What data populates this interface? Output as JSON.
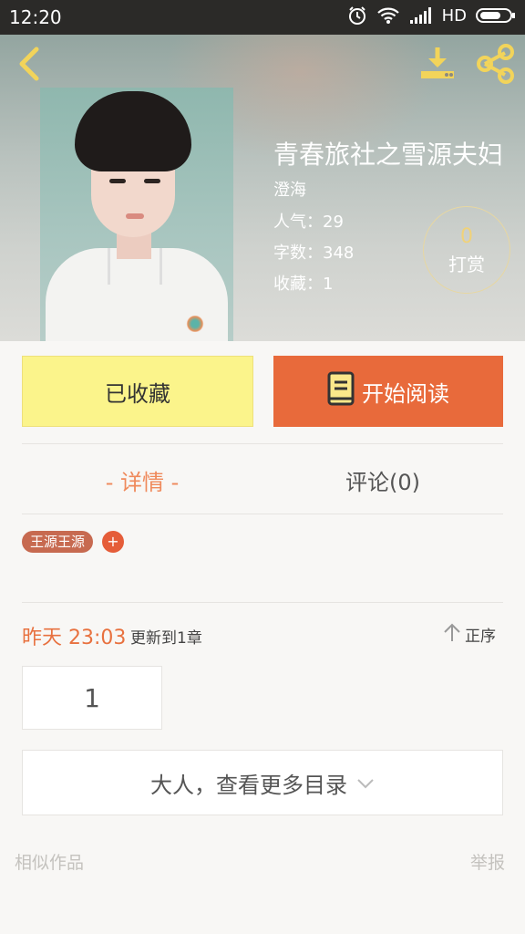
{
  "status_bar": {
    "time": "12:20",
    "network": "HD"
  },
  "header": {
    "icons": {
      "back": "back-arrow-icon",
      "download": "download-icon",
      "share": "share-icon"
    }
  },
  "book": {
    "title": "青春旅社之雪源夫妇",
    "author": "澄海",
    "popularity": "人气：29",
    "word_count": "字数：348",
    "favorites": "收藏：1",
    "reward_count": "0",
    "reward_label": "打赏"
  },
  "actions": {
    "favorited_label": "已收藏",
    "read_label": "开始阅读"
  },
  "tabs": {
    "detail": "- 详情 -",
    "comments": "评论(0)"
  },
  "tags": [
    "王源王源"
  ],
  "tag_add": "+",
  "update": {
    "time": "昨天 23:03",
    "text": "更新到1章",
    "sort_label": "正序"
  },
  "chapters": [
    "1"
  ],
  "more_catalog": "大人，查看更多目录",
  "footer": {
    "similar": "相似作品",
    "report": "举报"
  },
  "colors": {
    "accent": "#e86a3b",
    "favorite_bg": "#fbf48b",
    "reward_gold": "#f0d27a"
  }
}
